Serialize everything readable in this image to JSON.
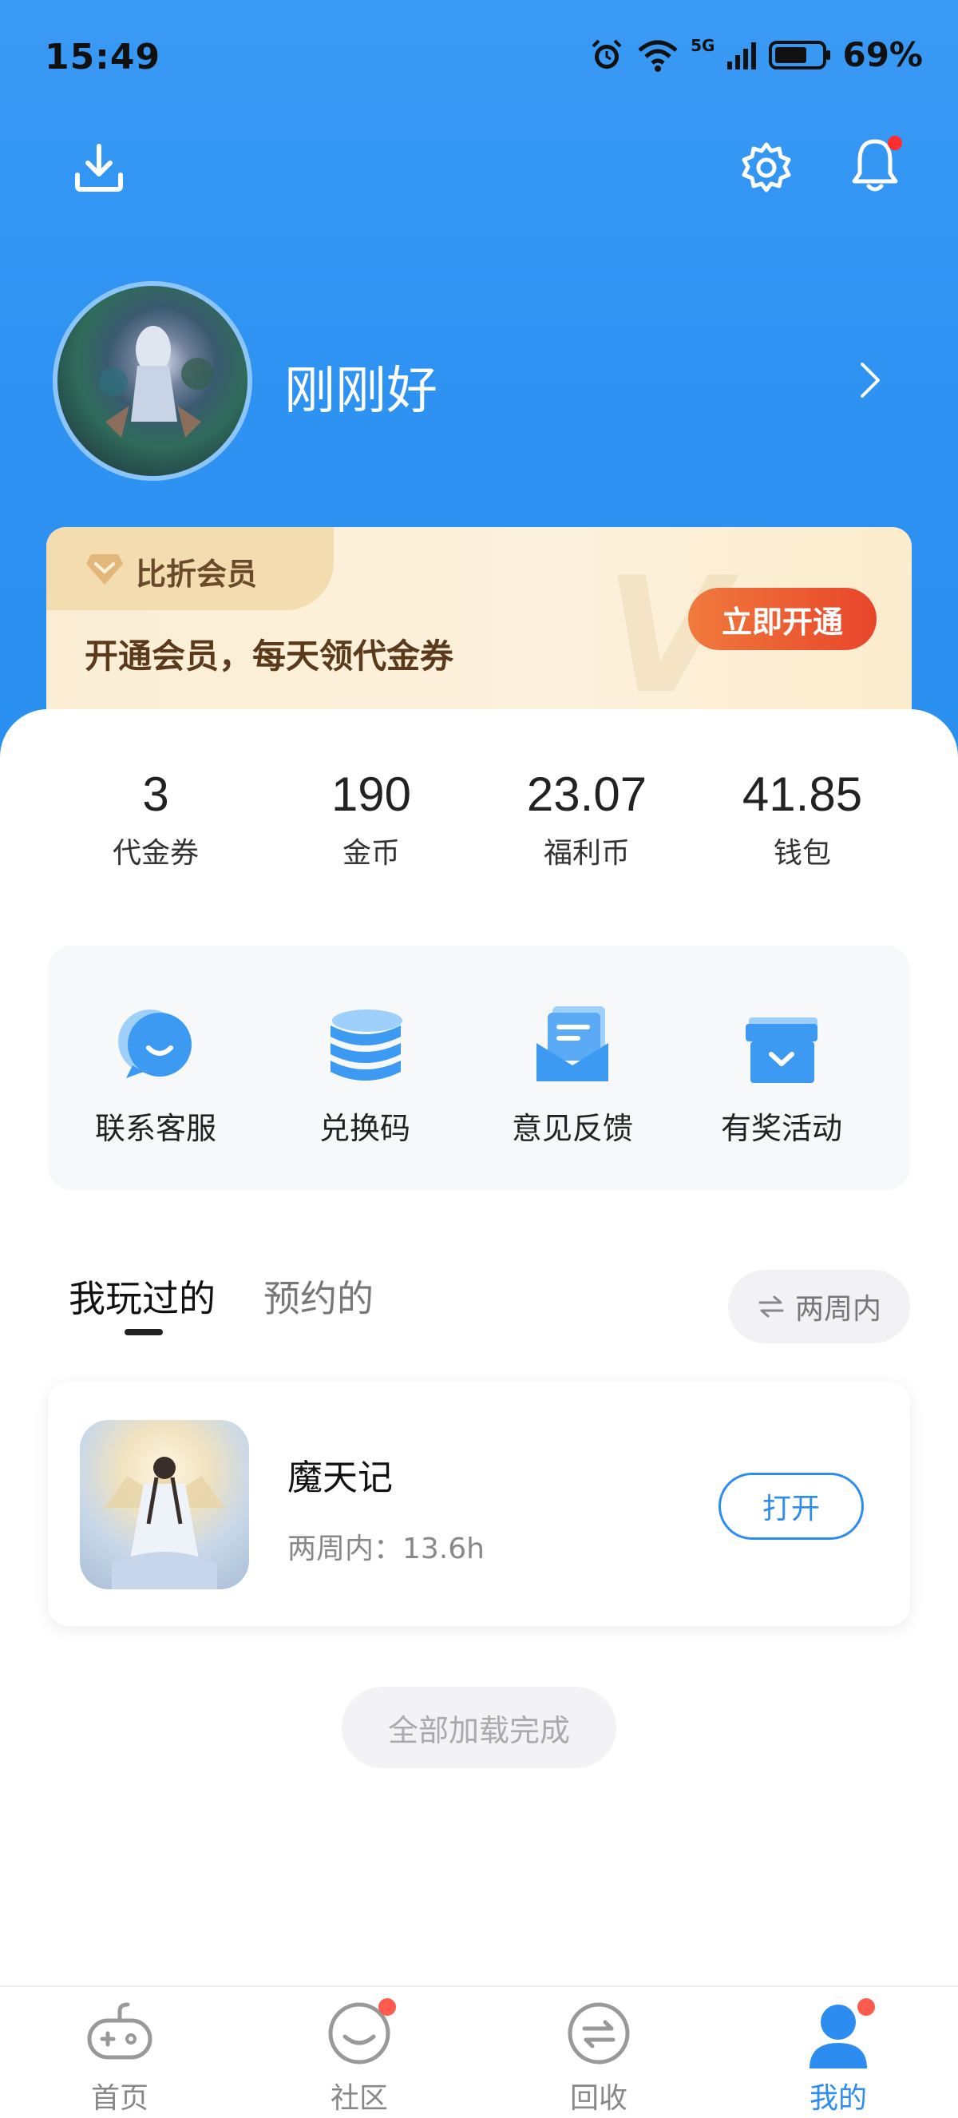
{
  "status_bar": {
    "time": "15:49",
    "network": "5G",
    "battery": "69%",
    "battery_level": 0.69
  },
  "header": {
    "download_icon": "download-icon",
    "settings_icon": "gear-icon",
    "bell_icon": "bell-icon",
    "has_notification": true
  },
  "profile": {
    "username": "刚刚好"
  },
  "vip": {
    "tag": "比折会员",
    "description": "开通会员，每天领代金券",
    "button": "立即开通",
    "watermark": "V"
  },
  "stats": [
    {
      "value": "3",
      "label": "代金券"
    },
    {
      "value": "190",
      "label": "金币"
    },
    {
      "value": "23.07",
      "label": "福利币"
    },
    {
      "value": "41.85",
      "label": "钱包"
    }
  ],
  "tools": [
    {
      "label": "联系客服",
      "icon": "chat-bubble-icon"
    },
    {
      "label": "兑换码",
      "icon": "coin-stack-icon"
    },
    {
      "label": "意见反馈",
      "icon": "envelope-icon"
    },
    {
      "label": "有奖活动",
      "icon": "gift-box-icon"
    }
  ],
  "tabs": {
    "played": "我玩过的",
    "reserved": "预约的",
    "active": "played"
  },
  "period_filter": {
    "label": "两周内",
    "icon": "swap-arrows-icon"
  },
  "games": [
    {
      "name": "魔天记",
      "playtime": "两周内：13.6h",
      "button": "打开"
    }
  ],
  "load_status": "全部加载完成",
  "bottom_nav": [
    {
      "label": "首页",
      "icon": "gamepad-icon",
      "active": false,
      "badge": false
    },
    {
      "label": "社区",
      "icon": "smile-bubble-icon",
      "active": false,
      "badge": true
    },
    {
      "label": "回收",
      "icon": "recycle-exchange-icon",
      "active": false,
      "badge": false
    },
    {
      "label": "我的",
      "icon": "user-icon",
      "active": true,
      "badge": true
    }
  ],
  "colors": {
    "primary": "#2d8cf0",
    "header_bg": "#3a9af5",
    "vip_button": "#e8452a",
    "badge": "#ff5a4e"
  }
}
